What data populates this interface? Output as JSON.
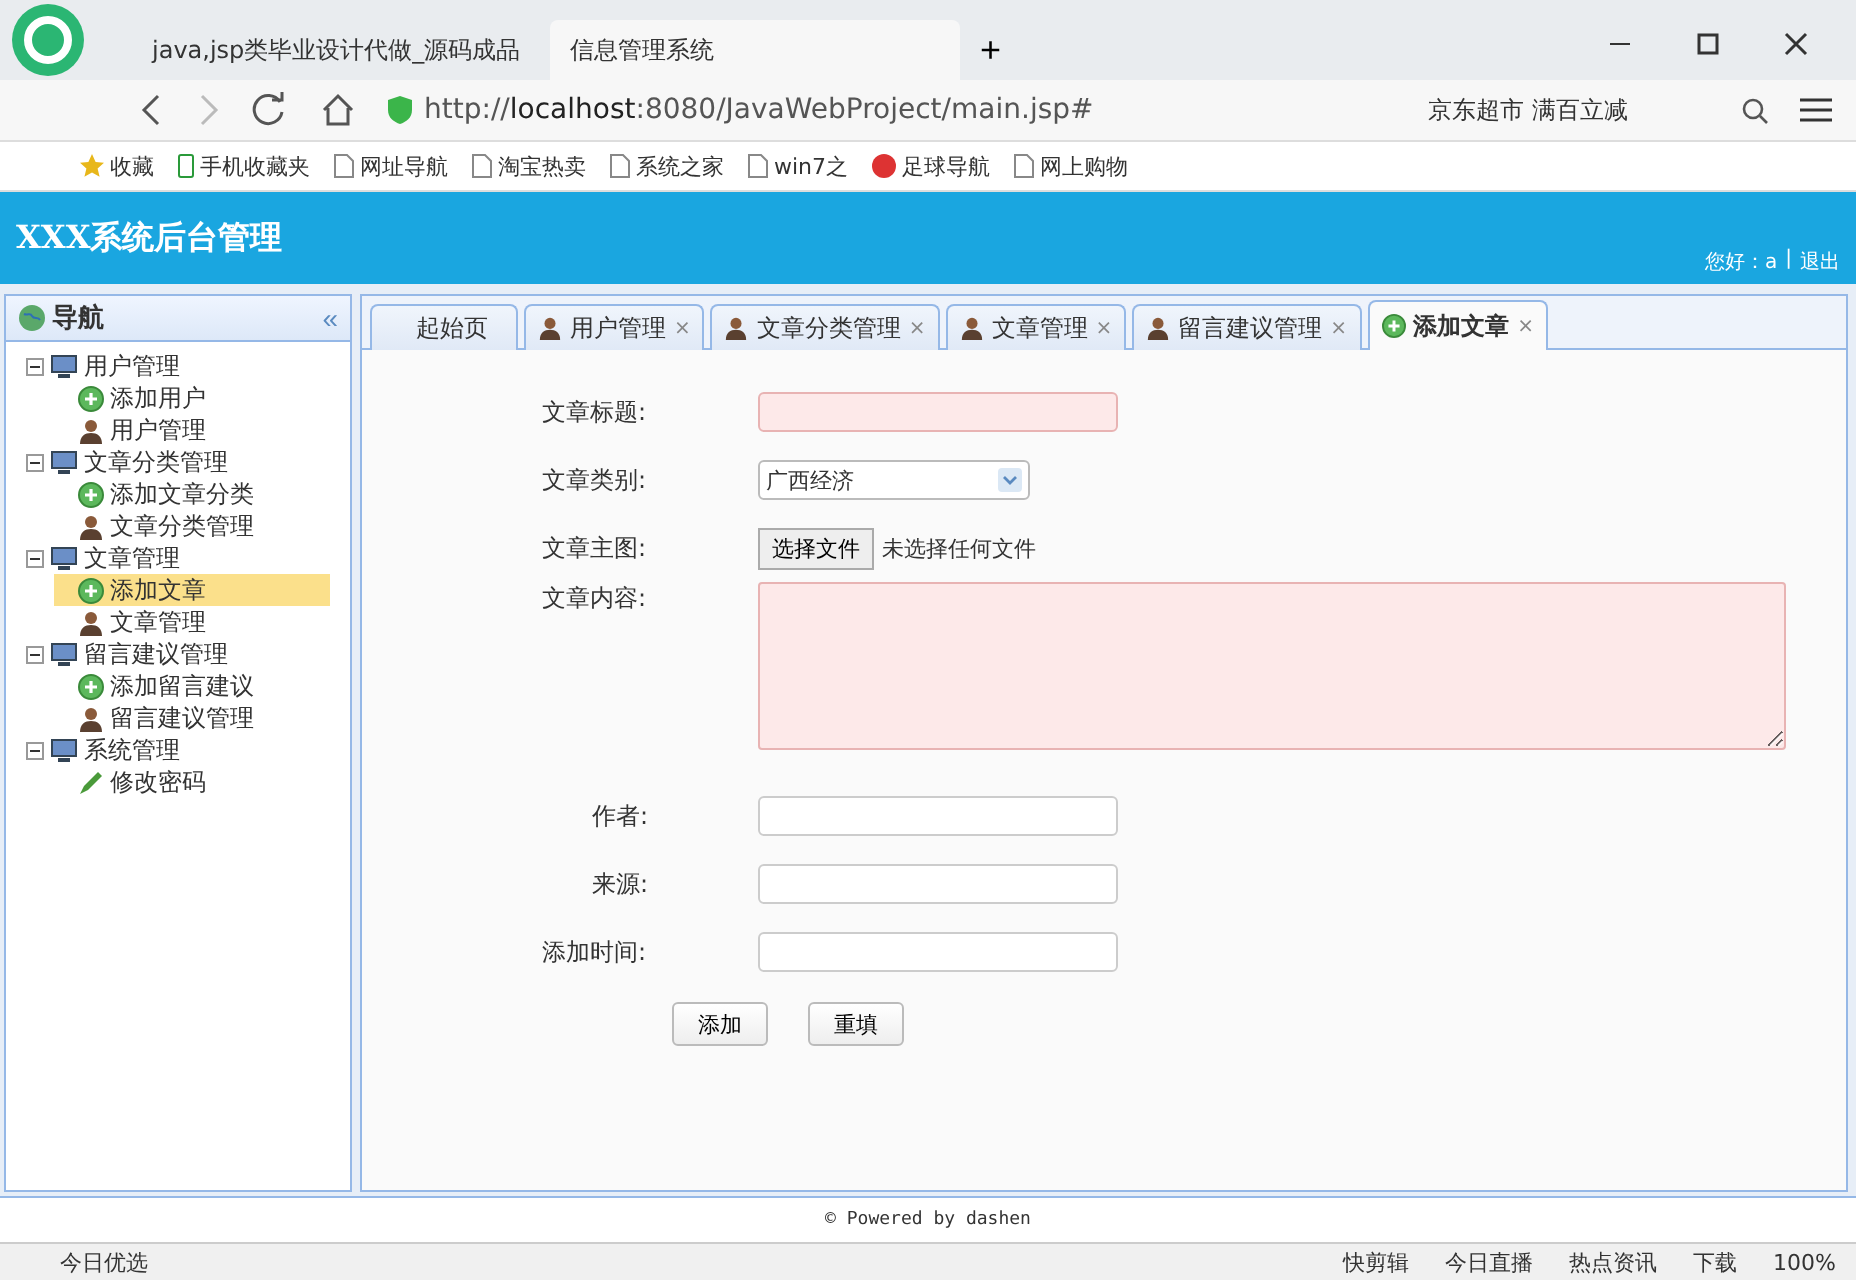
{
  "browser": {
    "tabs": [
      {
        "title": "java,jsp类毕业设计代做_源码成品",
        "selected": false
      },
      {
        "title": "信息管理系统",
        "selected": true
      }
    ],
    "new_tab": "+",
    "url_prefix": "http://",
    "url_host": "localhost",
    "url_rest": ":8080/JavaWebProject/main.jsp#",
    "search_text": "京东超市 满百立减",
    "bookmarks": [
      {
        "label": "收藏",
        "kind": "star"
      },
      {
        "label": "手机收藏夹",
        "kind": "phone"
      },
      {
        "label": "网址导航",
        "kind": "page"
      },
      {
        "label": "淘宝热卖",
        "kind": "page"
      },
      {
        "label": "系统之家",
        "kind": "page"
      },
      {
        "label": "win7之",
        "kind": "page"
      },
      {
        "label": "足球导航",
        "kind": "ball"
      },
      {
        "label": "网上购物",
        "kind": "page"
      }
    ]
  },
  "header": {
    "title": "XXX系统后台管理",
    "greeting": "您好：a",
    "separator": "|",
    "logout": "退出"
  },
  "sidebar": {
    "title": "导航",
    "collapse": "«",
    "items": [
      {
        "label": "用户管理",
        "expanded": true,
        "children": [
          {
            "label": "添加用户",
            "kind": "add",
            "selected": false
          },
          {
            "label": "用户管理",
            "kind": "user",
            "selected": false
          }
        ]
      },
      {
        "label": "文章分类管理",
        "expanded": true,
        "children": [
          {
            "label": "添加文章分类",
            "kind": "add",
            "selected": false
          },
          {
            "label": "文章分类管理",
            "kind": "user",
            "selected": false
          }
        ]
      },
      {
        "label": "文章管理",
        "expanded": true,
        "children": [
          {
            "label": "添加文章",
            "kind": "add",
            "selected": true
          },
          {
            "label": "文章管理",
            "kind": "user",
            "selected": false
          }
        ]
      },
      {
        "label": "留言建议管理",
        "expanded": true,
        "children": [
          {
            "label": "添加留言建议",
            "kind": "add",
            "selected": false
          },
          {
            "label": "留言建议管理",
            "kind": "user",
            "selected": false
          }
        ]
      },
      {
        "label": "系统管理",
        "expanded": true,
        "children": [
          {
            "label": "修改密码",
            "kind": "edit",
            "selected": false
          }
        ]
      }
    ]
  },
  "tabs": [
    {
      "label": "起始页",
      "kind": "home",
      "closable": false,
      "selected": false
    },
    {
      "label": "用户管理",
      "kind": "user",
      "closable": true,
      "selected": false
    },
    {
      "label": "文章分类管理",
      "kind": "user",
      "closable": true,
      "selected": false
    },
    {
      "label": "文章管理",
      "kind": "user",
      "closable": true,
      "selected": false
    },
    {
      "label": "留言建议管理",
      "kind": "user",
      "closable": true,
      "selected": false
    },
    {
      "label": "添加文章",
      "kind": "add",
      "closable": true,
      "selected": true
    }
  ],
  "close_mark": "×",
  "form": {
    "fields": [
      {
        "label": "文章标题:",
        "kind": "text",
        "required": true
      },
      {
        "label": "文章类别:",
        "kind": "select",
        "value": "广西经济"
      },
      {
        "label": "文章主图:",
        "kind": "file",
        "button": "选择文件",
        "status": "未选择任何文件"
      },
      {
        "label": "文章内容:",
        "kind": "textarea",
        "required": true
      },
      {
        "label": "作者:",
        "kind": "text",
        "required": false
      },
      {
        "label": "来源:",
        "kind": "text",
        "required": false
      },
      {
        "label": "添加时间:",
        "kind": "text",
        "required": false
      }
    ],
    "buttons": [
      "添加",
      "重填"
    ]
  },
  "footer": "© Powered by dashen",
  "status_bar": {
    "left": "今日优选",
    "items": [
      "快剪辑",
      "今日直播",
      "热点资讯",
      "下载"
    ],
    "zoom": "100%"
  }
}
